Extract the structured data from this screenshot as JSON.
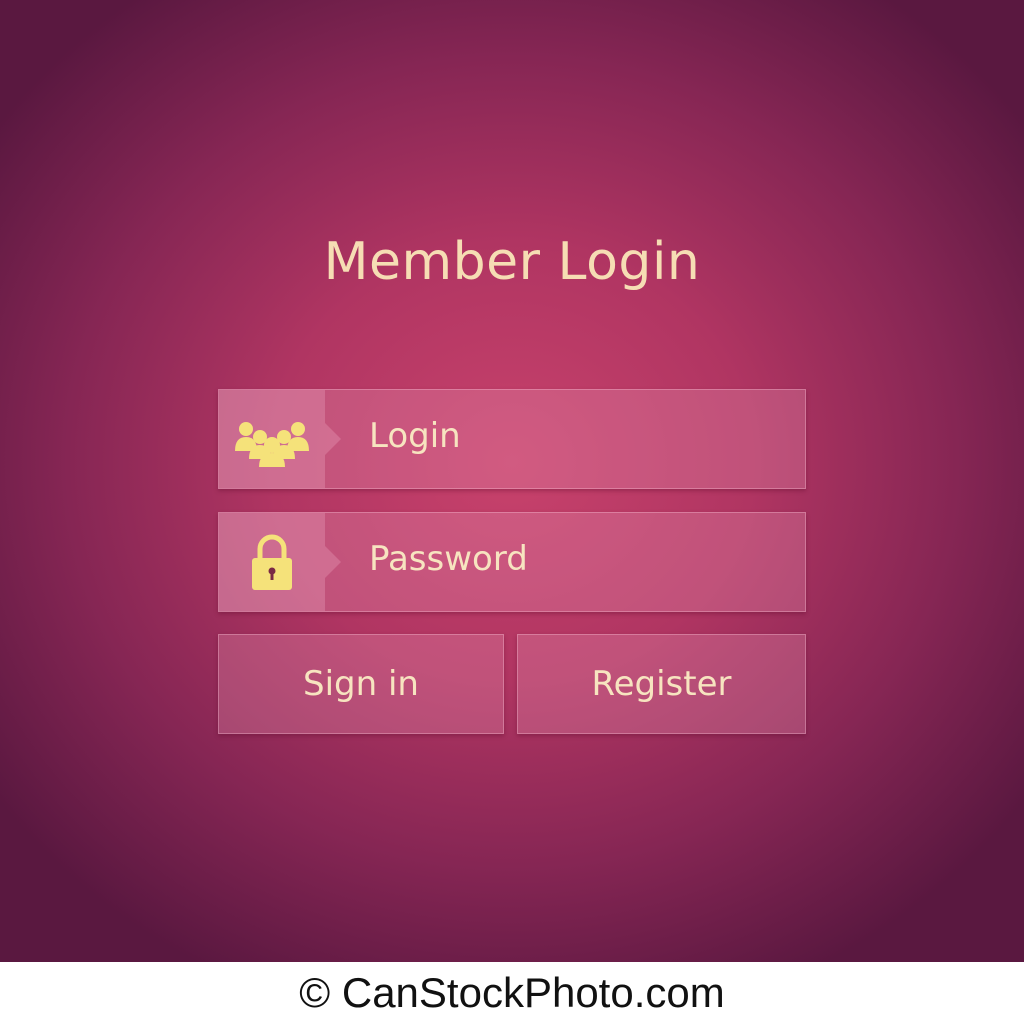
{
  "title": "Member Login",
  "form": {
    "login_placeholder": "Login",
    "password_placeholder": "Password",
    "login_icon": "user-group-icon",
    "password_icon": "padlock-icon"
  },
  "buttons": {
    "sign_in": "Sign in",
    "register": "Register"
  },
  "watermark": "© CanStockPhoto.com",
  "colors": {
    "background": "#b03562",
    "text": "#f7e4c0",
    "icon": "#f5e27a"
  }
}
